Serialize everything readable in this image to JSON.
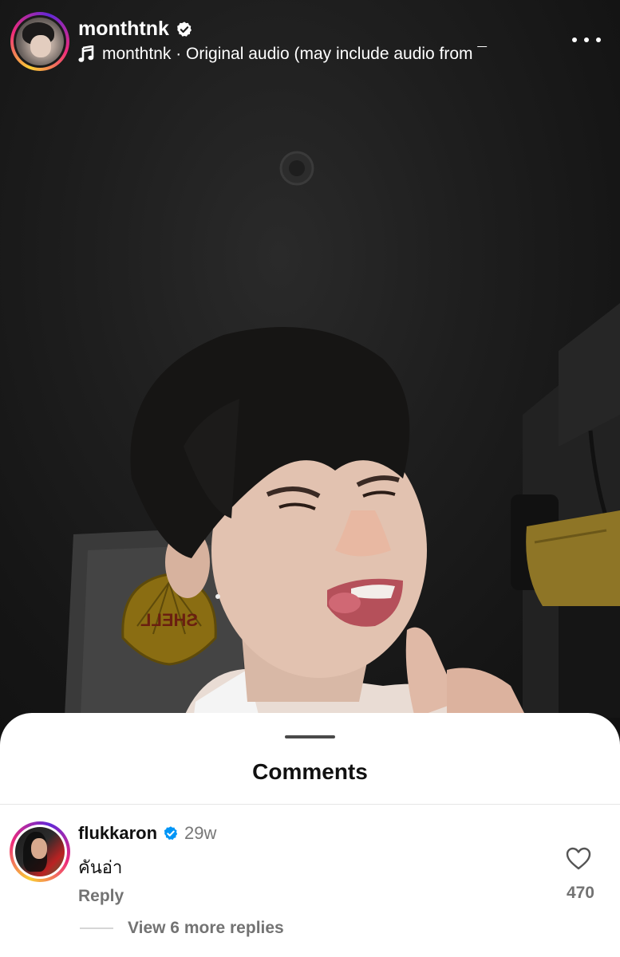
{
  "post": {
    "username": "monthtnk",
    "audio_text": "monthtnk · Original audio  (may include audio from ¯",
    "sign_text": "SHELL"
  },
  "comments_sheet": {
    "title": "Comments",
    "comments": [
      {
        "username": "flukkaron",
        "time": "29w",
        "text": "คันอ่า",
        "reply_label": "Reply",
        "like_count": "470",
        "view_replies_label": "View 6 more replies"
      }
    ]
  },
  "colors": {
    "verified_blue": "#0095f6",
    "story_ring": [
      "#f9ce34",
      "#ee2a7b",
      "#6228d7"
    ]
  },
  "icons": [
    "verified-badge-icon",
    "music-note-icon",
    "more-options-icon",
    "heart-icon"
  ]
}
